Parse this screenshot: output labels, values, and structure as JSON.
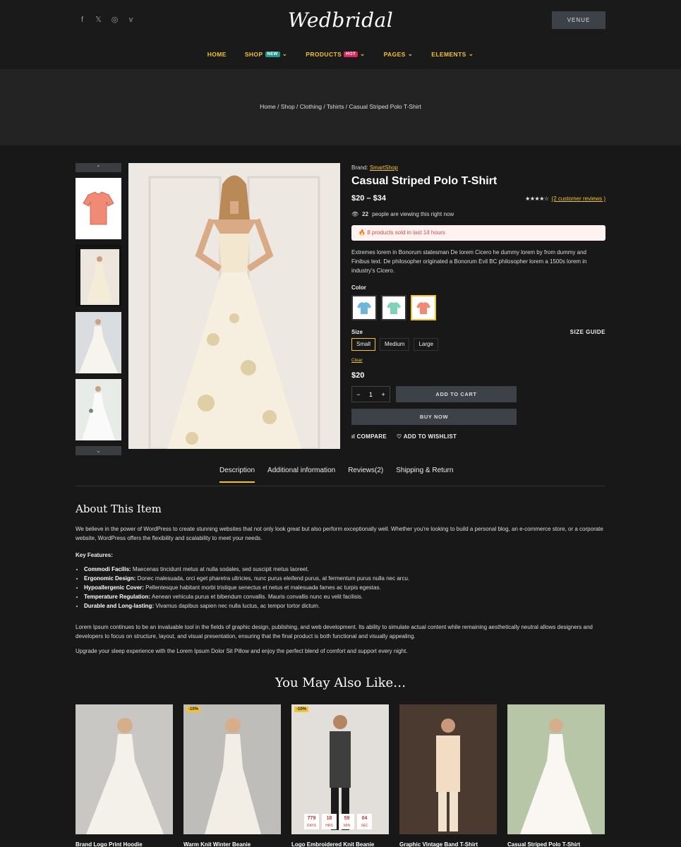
{
  "header": {
    "logo": "Wedbridal",
    "venue_button": "VENUE",
    "socials": [
      "facebook-icon",
      "x-icon",
      "instagram-icon",
      "vimeo-icon"
    ],
    "nav": [
      {
        "label": "HOME",
        "badge": ""
      },
      {
        "label": "SHOP",
        "badge": "NEW"
      },
      {
        "label": "PRODUCTS",
        "badge": "HOT"
      },
      {
        "label": "PAGES",
        "badge": ""
      },
      {
        "label": "ELEMENTS",
        "badge": ""
      }
    ]
  },
  "breadcrumb": "Home / Shop / Clothing / Tshirts / Casual Striped Polo T-Shirt",
  "product": {
    "brand_label": "Brand:",
    "brand": "SmartShop",
    "title": "Casual Striped Polo T-Shirt",
    "price_range": "$20 – $34",
    "rating_stars": "★★★★☆",
    "reviews_link": "(2 customer reviews )",
    "viewing_count": "22",
    "viewing_text": "people are viewing this right now",
    "sold_text": "8 products sold in last 14 hours",
    "description": "Extremes lorem in Bonorum statesman De lorem Cicero he dummy lorem by from dummy and Finibus text. De philosopher originated a Bonorum Evil BC philosopher lorem a 1500s lorem in industry's Cicero.",
    "color_label": "Color",
    "size_label": "Size",
    "size_guide": "SIZE GUIDE",
    "sizes": [
      "Small",
      "Medium",
      "Large"
    ],
    "clear": "Clear",
    "current_price": "$20",
    "qty": "1",
    "qty_minus": "−",
    "qty_plus": "+",
    "add_to_cart": "ADD TO CART",
    "buy_now": "BUY NOW",
    "compare": "COMPARE",
    "wishlist": "ADD TO WISHLIST",
    "colors": {
      "accent": "#f1c232",
      "button": "#3d4148"
    }
  },
  "tabs": [
    "Description",
    "Additional information",
    "Reviews(2)",
    "Shipping & Return"
  ],
  "about": {
    "title": "About This Item",
    "intro": "We believe in the power of WordPress to create stunning websites that not only look great but also perform exceptionally well. Whether you're looking to build a personal blog, an e-commerce store, or a corporate website, WordPress offers the flexibility and scalability to meet your needs.",
    "key_features": "Key Features:",
    "features": [
      {
        "name": "Commodi Facilis:",
        "text": " Maecenas tincidunt metus at nulla sodales, sed suscipit metus laoreet."
      },
      {
        "name": "Ergonomic Design:",
        "text": " Donec malesuada, orci eget pharetra ultricies, nunc purus eleifend purus, at fermentum purus nulla nec arcu."
      },
      {
        "name": "Hypoallergenic Cover:",
        "text": " Pellentesque habitant morbi tristique senectus et netus et malesuada fames ac turpis egestas."
      },
      {
        "name": "Temperature Regulation:",
        "text": " Aenean vehicula purus et bibendum convallis. Mauris convallis nunc eu velit facilisis."
      },
      {
        "name": "Durable and Long-lasting:",
        "text": " Vivamus dapibus sapien nec nulla luctus, ac tempor tortor dictum."
      }
    ],
    "para2": "Lorem Ipsum continues to be an invaluable tool in the fields of graphic design, publishing, and web development. Its ability to simulate actual content while remaining aesthetically neutral allows designers and developers to focus on structure, layout, and visual presentation, ensuring that the final product is both functional and visually appealing.",
    "para3": "Upgrade your sleep experience with the Lorem Ipsum Dolor Sit Pillow and enjoy the perfect blend of comfort and support every night."
  },
  "related": {
    "title": "You May Also Like…",
    "items": [
      {
        "name": "Brand Logo Print Hoodie",
        "discount": "",
        "stars": "★★★★★"
      },
      {
        "name": "Warm Knit Winter Beanie",
        "discount": "-10%",
        "stars": "★★★★★"
      },
      {
        "name": "Logo Embroidered Knit Beanie",
        "discount": "-10%",
        "stars": "★★★★★"
      },
      {
        "name": "Graphic Vintage Band T-Shirt",
        "discount": "",
        "stars": "★★★★★"
      },
      {
        "name": "Casual Striped Polo T-Shirt",
        "discount": "",
        "stars": "★★★★☆"
      }
    ],
    "timer": [
      {
        "v": "779",
        "u": "DAYS"
      },
      {
        "v": "18",
        "u": "HRS"
      },
      {
        "v": "59",
        "u": "MIN"
      },
      {
        "v": "04",
        "u": "SEC"
      }
    ]
  }
}
